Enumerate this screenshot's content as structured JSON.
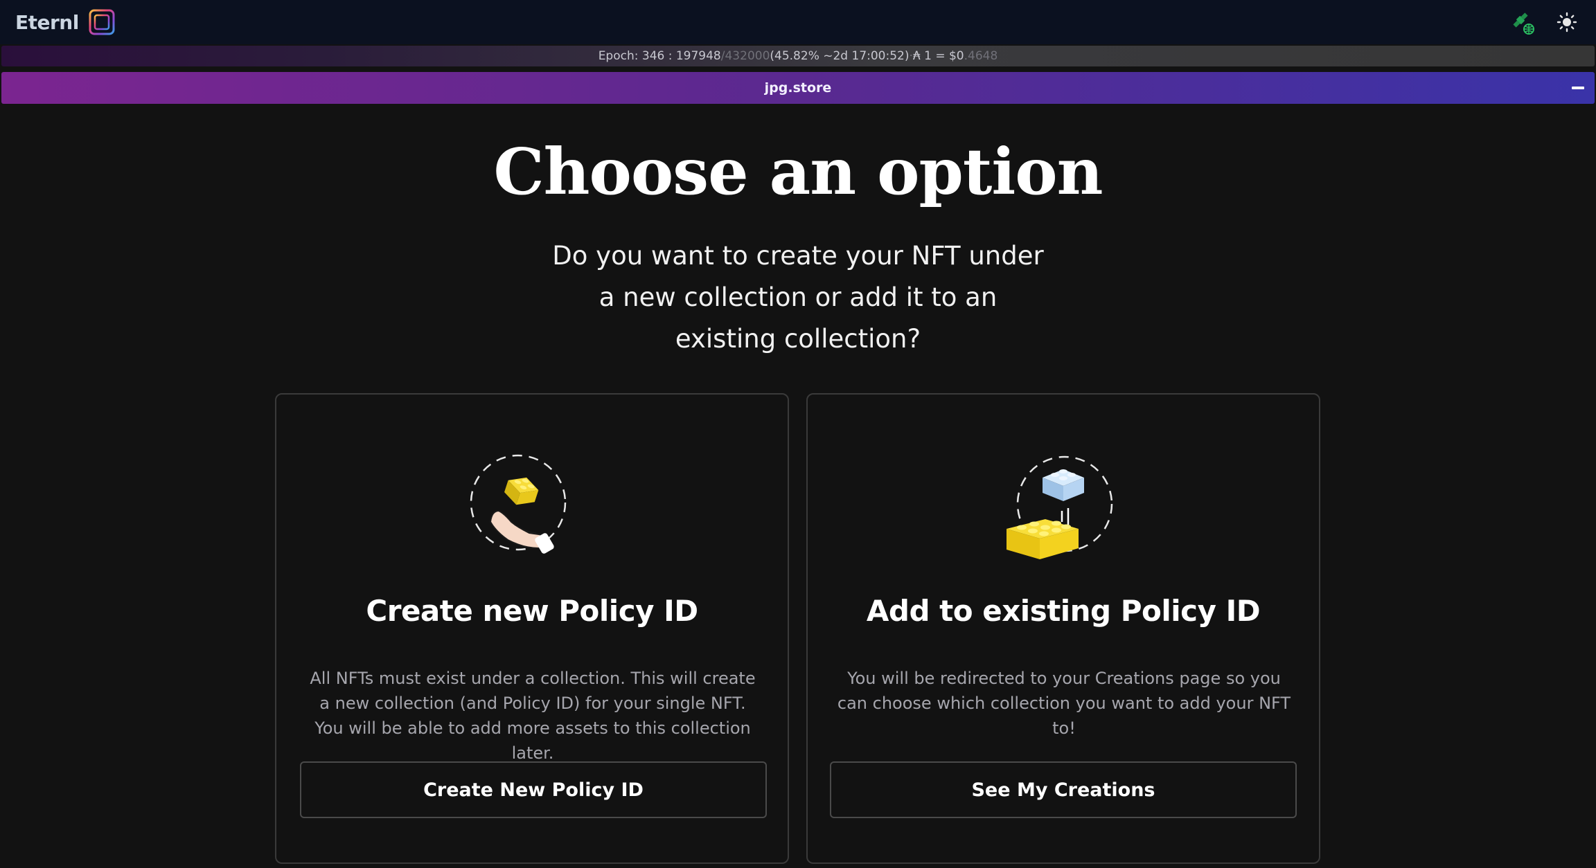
{
  "app": {
    "name": "Eternl"
  },
  "epoch_bar": {
    "epoch_label": "Epoch: 346 : 197948",
    "epoch_total": "/432000",
    "progress_text": " (45.82% ~2d 17:00:52)",
    "separator": " · ",
    "price_prefix": "₳ 1 = $0",
    "price_decimals": ".4648"
  },
  "store_bar": {
    "title": "jpg.store"
  },
  "main": {
    "heading": "Choose an option",
    "subtitle": "Do you want to create your NFT under a new collection or add it to an existing collection?"
  },
  "cards": [
    {
      "title": "Create new Policy ID",
      "description": "All NFTs must exist under a collection. This will create a new collection (and Policy ID) for your single NFT. You will be able to add more assets to this collection later.",
      "button_label": "Create New Policy ID",
      "illustration_icon": "hand-holding-brick-icon"
    },
    {
      "title": "Add to existing Policy ID",
      "description": "You will be redirected to your Creations page so you can choose which collection you want to add your NFT to!",
      "button_label": "See My Creations",
      "illustration_icon": "stacking-bricks-icon"
    }
  ],
  "icons": {
    "network": "satellite-globe-icon",
    "theme": "sun-icon",
    "collapse": "minus-icon"
  },
  "colors": {
    "background": "#121212",
    "header": "#0b1120",
    "store_gradient_start": "#7b2590",
    "store_gradient_end": "#3a33a8",
    "brick_yellow": "#f5d51e",
    "brick_blue": "#bcd9f5",
    "network_green": "#22a35a"
  }
}
